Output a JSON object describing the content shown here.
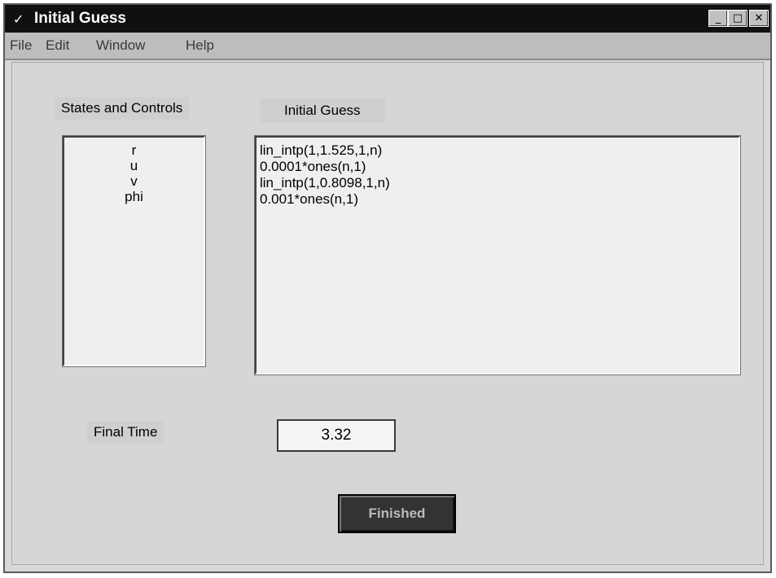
{
  "window": {
    "title": "Initial Guess",
    "title_icon": "check-icon",
    "controls": {
      "minimize": "_",
      "maximize": "□",
      "close": "✕"
    }
  },
  "menu": {
    "items": [
      "File",
      "Edit",
      "Window",
      "Help"
    ]
  },
  "labels": {
    "states_and_controls": "States and Controls",
    "initial_guess": "Initial Guess",
    "final_time": "Final Time"
  },
  "states": [
    "r",
    "u",
    "v",
    "phi"
  ],
  "guesses": [
    "lin_intp(1,1.525,1,n)",
    "0.0001*ones(n,1)",
    "lin_intp(1,0.8098,1,n)",
    "0.001*ones(n,1)"
  ],
  "final_time_value": "3.32",
  "finished_button": "Finished"
}
